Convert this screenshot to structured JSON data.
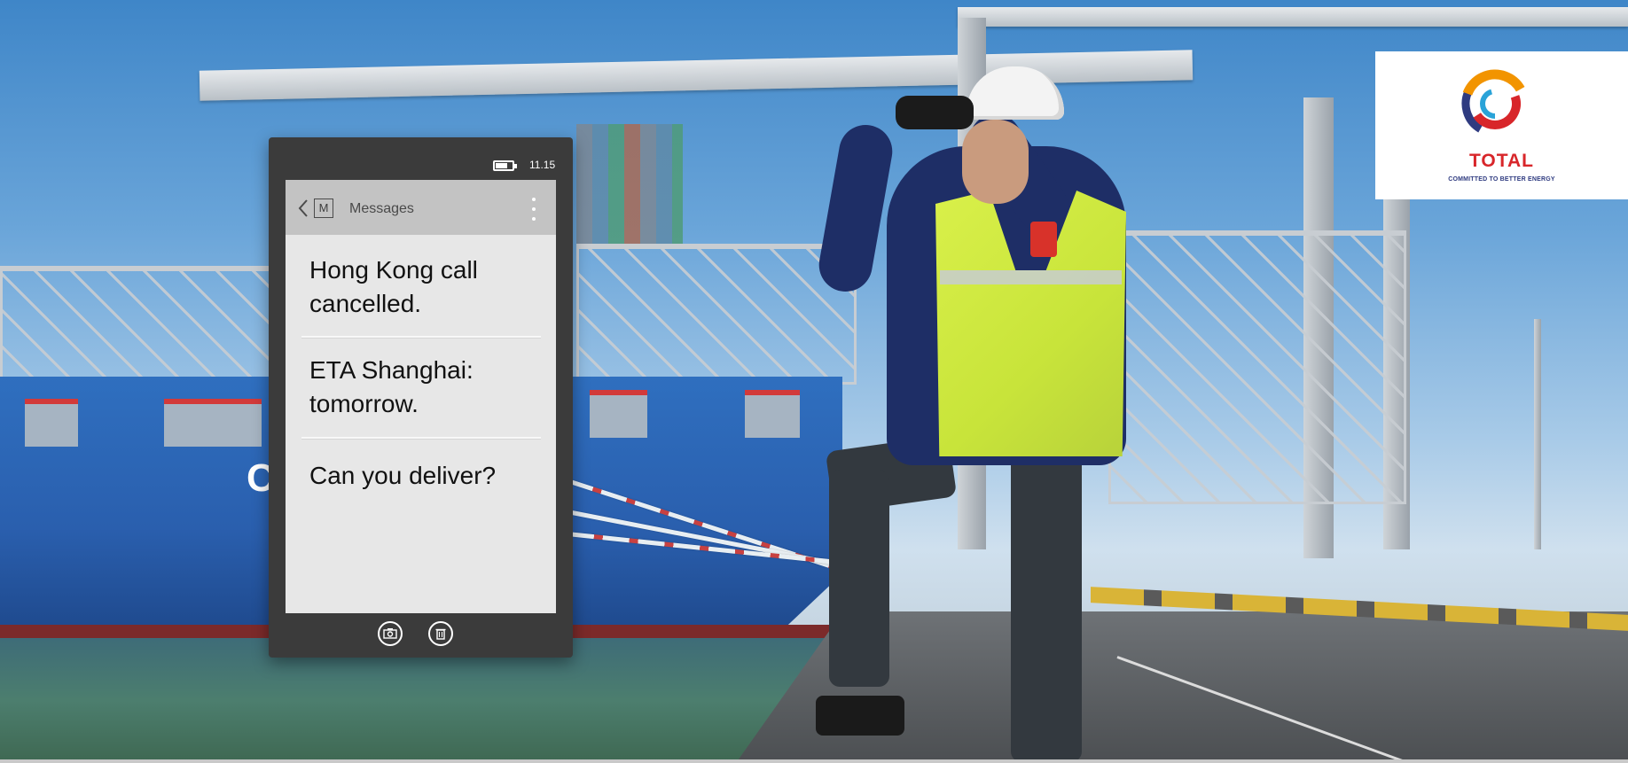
{
  "phone": {
    "clock": "11.15",
    "battery_level": 0.7,
    "header": {
      "m_label": "M",
      "title": "Messages"
    },
    "messages": [
      "Hong Kong call cancelled.",
      "ETA Shanghai: tomorrow.",
      "Can you deliver?"
    ],
    "icons": [
      "back-icon",
      "mail-icon",
      "more-vertical-icon",
      "camera-icon",
      "trash-icon"
    ]
  },
  "brand": {
    "name": "TOTAL",
    "tagline": "COMMITTED TO BETTER ENERGY",
    "colors": {
      "red": "#d8262a",
      "orange": "#f29400",
      "blue": "#2f3b80"
    }
  },
  "scene": {
    "ship_letter": "C"
  }
}
